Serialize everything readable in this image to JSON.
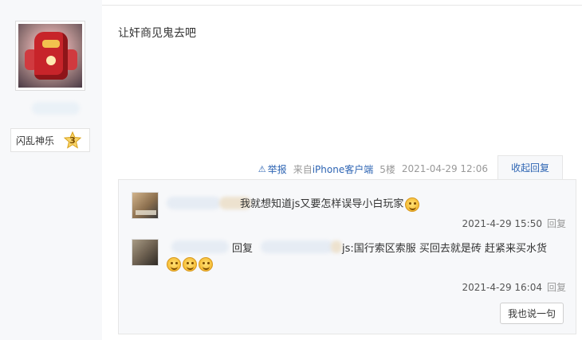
{
  "user": {
    "level_name": "闪乱神乐",
    "level": "3",
    "avatar_icon": "robot-avatar"
  },
  "post": {
    "text": "让奸商见鬼去吧"
  },
  "tail": {
    "report": "举报",
    "from": "来自",
    "client": "iPhone客户端",
    "floor": "5楼",
    "time": "2021-04-29 12:06",
    "collapse": "收起回复"
  },
  "replies": [
    {
      "content": "我就想知道js又要怎样误导小白玩家",
      "time": "2021-4-29 15:50",
      "reply_label": "回复"
    },
    {
      "reply_word": "回复",
      "content_line1": "js:国行索区索服 买回去就是砖 赶紧来买水货",
      "time": "2021-4-29 16:04",
      "reply_label": "回复"
    }
  ],
  "say_button": "我也说一句",
  "colors": {
    "link": "#2d64b3",
    "panel": "#f7f8fa",
    "border": "#e6e6e6"
  }
}
